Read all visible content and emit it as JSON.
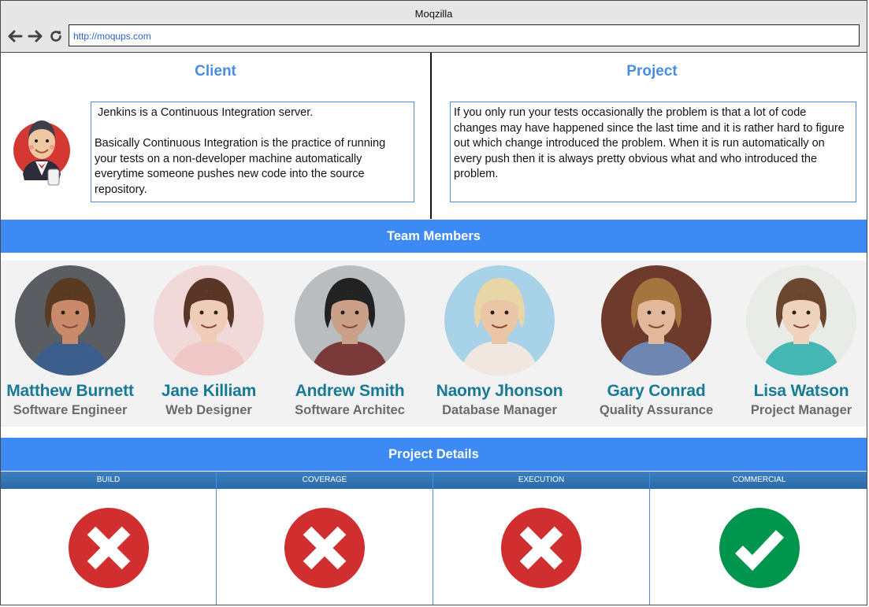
{
  "window": {
    "title": "Moqzilla",
    "url": "http://moqups.com"
  },
  "client": {
    "title": "Client",
    "text": " Jenkins is a Continuous Integration server.\n\nBasically Continuous Integration is the practice of running your tests on a non-developer machine automatically everytime someone pushes new code into the source repository."
  },
  "project": {
    "title": "Project",
    "text": "If you only run your tests occasionally the problem is that a lot of code changes may have happened since the last time and it is rather hard to figure out which change introduced the problem. When it is run automatically on every push then it is always pretty obvious what and who introduced the problem."
  },
  "team": {
    "title": "Team Members",
    "members": [
      {
        "name": "Matthew Burnett",
        "role": "Software Engineer",
        "bg": "#5a5e63",
        "skin": "#c88a6a",
        "hair": "#5b3a22",
        "shirt": "#3c5e8c"
      },
      {
        "name": "Jane Killiam",
        "role": "Web Designer",
        "bg": "#f1d9d9",
        "skin": "#f0cdb8",
        "hair": "#5a3626",
        "shirt": "#f0c8c8"
      },
      {
        "name": "Andrew Smith",
        "role": "Software Architec",
        "bg": "#b9bdbf",
        "skin": "#caa088",
        "hair": "#222222",
        "shirt": "#7a3a3a"
      },
      {
        "name": "Naomy Jhonson",
        "role": "Database Manager",
        "bg": "#a7d2e7",
        "skin": "#eac5a6",
        "hair": "#e9d6a6",
        "shirt": "#efe7e0"
      },
      {
        "name": "Gary Conrad",
        "role": "Quality Assurance",
        "bg": "#6e3a2c",
        "skin": "#e2b79a",
        "hair": "#a6743f",
        "shirt": "#6f86b2"
      },
      {
        "name": "Lisa Watson",
        "role": "Project Manager",
        "bg": "#e8ebe6",
        "skin": "#f0d2bd",
        "hair": "#6b4630",
        "shirt": "#44b7b5"
      }
    ]
  },
  "details": {
    "title": "Project Details",
    "columns": [
      {
        "label": "BUILD",
        "status": "fail",
        "icon": "x-icon"
      },
      {
        "label": "COVERAGE",
        "status": "fail",
        "icon": "x-icon"
      },
      {
        "label": "EXECUTION",
        "status": "fail",
        "icon": "x-icon"
      },
      {
        "label": "COMMERCIAL",
        "status": "pass",
        "icon": "check-icon"
      }
    ],
    "colors": {
      "fail": "#d12f2f",
      "pass": "#00954c"
    }
  }
}
